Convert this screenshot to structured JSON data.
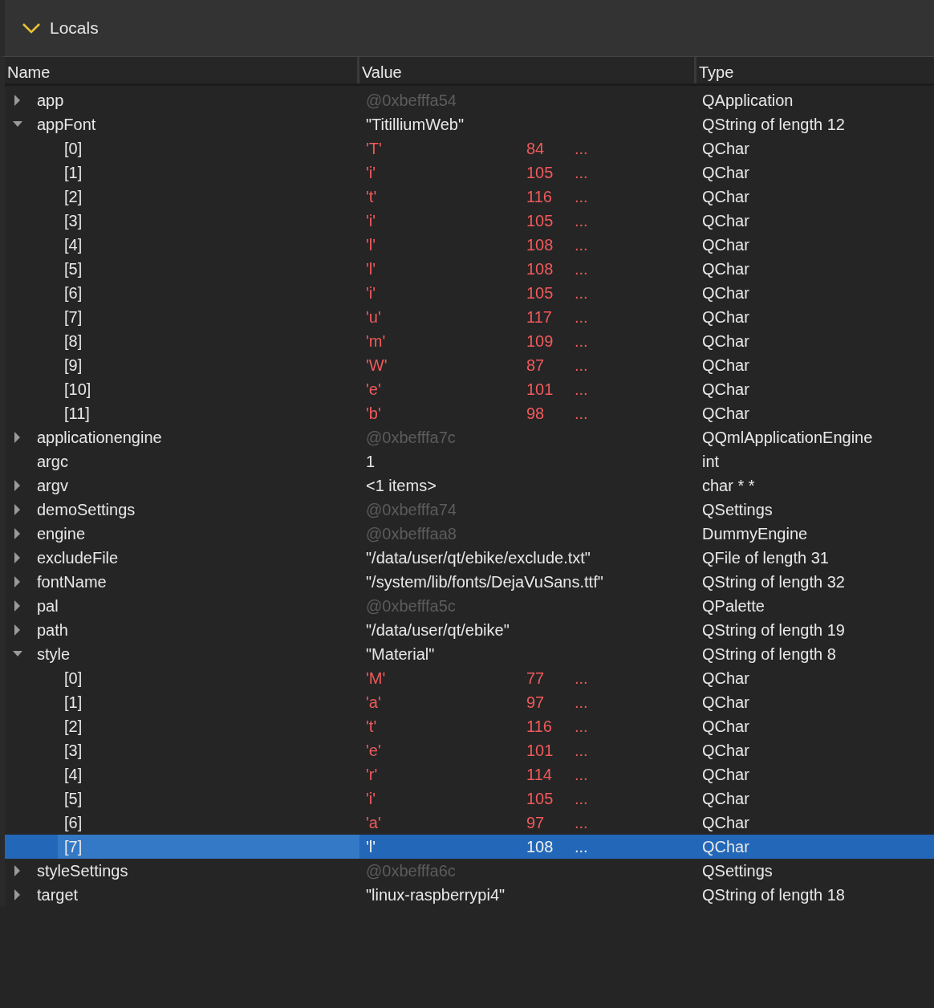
{
  "section": {
    "title": "Locals",
    "expanded": true
  },
  "columns": [
    "Name",
    "Value",
    "Type"
  ],
  "items": [
    {
      "name": "app",
      "kind": "address",
      "value": "@0xbefffa54",
      "type": "QApplication",
      "expandable": true,
      "expanded": false,
      "selected": false
    },
    {
      "name": "appFont",
      "kind": "text",
      "value": "\"TitilliumWeb\"",
      "type": "QString of length 12",
      "expandable": true,
      "expanded": true,
      "selected": false,
      "children": [
        {
          "name": "[0]",
          "kind": "char",
          "value": "'T'",
          "code": "84",
          "more": "...",
          "type": "QChar",
          "selected": false
        },
        {
          "name": "[1]",
          "kind": "char",
          "value": "'i'",
          "code": "105",
          "more": "...",
          "type": "QChar",
          "selected": false
        },
        {
          "name": "[2]",
          "kind": "char",
          "value": "'t'",
          "code": "116",
          "more": "...",
          "type": "QChar",
          "selected": false
        },
        {
          "name": "[3]",
          "kind": "char",
          "value": "'i'",
          "code": "105",
          "more": "...",
          "type": "QChar",
          "selected": false
        },
        {
          "name": "[4]",
          "kind": "char",
          "value": "'l'",
          "code": "108",
          "more": "...",
          "type": "QChar",
          "selected": false
        },
        {
          "name": "[5]",
          "kind": "char",
          "value": "'l'",
          "code": "108",
          "more": "...",
          "type": "QChar",
          "selected": false
        },
        {
          "name": "[6]",
          "kind": "char",
          "value": "'i'",
          "code": "105",
          "more": "...",
          "type": "QChar",
          "selected": false
        },
        {
          "name": "[7]",
          "kind": "char",
          "value": "'u'",
          "code": "117",
          "more": "...",
          "type": "QChar",
          "selected": false
        },
        {
          "name": "[8]",
          "kind": "char",
          "value": "'m'",
          "code": "109",
          "more": "...",
          "type": "QChar",
          "selected": false
        },
        {
          "name": "[9]",
          "kind": "char",
          "value": "'W'",
          "code": "87",
          "more": "...",
          "type": "QChar",
          "selected": false
        },
        {
          "name": "[10]",
          "kind": "char",
          "value": "'e'",
          "code": "101",
          "more": "...",
          "type": "QChar",
          "selected": false
        },
        {
          "name": "[11]",
          "kind": "char",
          "value": "'b'",
          "code": "98",
          "more": "...",
          "type": "QChar",
          "selected": false
        }
      ]
    },
    {
      "name": "applicationengine",
      "kind": "address",
      "value": "@0xbefffa7c",
      "type": "QQmlApplicationEngine",
      "expandable": true,
      "expanded": false,
      "selected": false
    },
    {
      "name": "argc",
      "kind": "text",
      "value": "1",
      "type": "int",
      "expandable": false,
      "selected": false
    },
    {
      "name": "argv",
      "kind": "text",
      "value": "<1 items>",
      "type": "char * *",
      "expandable": true,
      "expanded": false,
      "selected": false
    },
    {
      "name": "demoSettings",
      "kind": "address",
      "value": "@0xbefffa74",
      "type": "QSettings",
      "expandable": true,
      "expanded": false,
      "selected": false
    },
    {
      "name": "engine",
      "kind": "address",
      "value": "@0xbefffaa8",
      "type": "DummyEngine",
      "expandable": true,
      "expanded": false,
      "selected": false
    },
    {
      "name": "excludeFile",
      "kind": "text",
      "value": "\"/data/user/qt/ebike/exclude.txt\"",
      "type": "QFile of length 31",
      "expandable": true,
      "expanded": false,
      "selected": false
    },
    {
      "name": "fontName",
      "kind": "text",
      "value": "\"/system/lib/fonts/DejaVuSans.ttf\"",
      "type": "QString of length 32",
      "expandable": true,
      "expanded": false,
      "selected": false
    },
    {
      "name": "pal",
      "kind": "address",
      "value": "@0xbefffa5c",
      "type": "QPalette",
      "expandable": true,
      "expanded": false,
      "selected": false
    },
    {
      "name": "path",
      "kind": "text",
      "value": "\"/data/user/qt/ebike\"",
      "type": "QString of length 19",
      "expandable": true,
      "expanded": false,
      "selected": false
    },
    {
      "name": "style",
      "kind": "text",
      "value": "\"Material\"",
      "type": "QString of length 8",
      "expandable": true,
      "expanded": true,
      "selected": false,
      "children": [
        {
          "name": "[0]",
          "kind": "char",
          "value": "'M'",
          "code": "77",
          "more": "...",
          "type": "QChar",
          "selected": false
        },
        {
          "name": "[1]",
          "kind": "char",
          "value": "'a'",
          "code": "97",
          "more": "...",
          "type": "QChar",
          "selected": false
        },
        {
          "name": "[2]",
          "kind": "char",
          "value": "'t'",
          "code": "116",
          "more": "...",
          "type": "QChar",
          "selected": false
        },
        {
          "name": "[3]",
          "kind": "char",
          "value": "'e'",
          "code": "101",
          "more": "...",
          "type": "QChar",
          "selected": false
        },
        {
          "name": "[4]",
          "kind": "char",
          "value": "'r'",
          "code": "114",
          "more": "...",
          "type": "QChar",
          "selected": false
        },
        {
          "name": "[5]",
          "kind": "char",
          "value": "'i'",
          "code": "105",
          "more": "...",
          "type": "QChar",
          "selected": false
        },
        {
          "name": "[6]",
          "kind": "char",
          "value": "'a'",
          "code": "97",
          "more": "...",
          "type": "QChar",
          "selected": false
        },
        {
          "name": "[7]",
          "kind": "char",
          "value": "'l'",
          "code": "108",
          "more": "...",
          "type": "QChar",
          "selected": true
        }
      ]
    },
    {
      "name": "styleSettings",
      "kind": "address",
      "value": "@0xbefffa6c",
      "type": "QSettings",
      "expandable": true,
      "expanded": false,
      "selected": false
    },
    {
      "name": "target",
      "kind": "text",
      "value": "\"linux-raspberrypi4\"",
      "type": "QString of length 18",
      "expandable": true,
      "expanded": false,
      "selected": false
    }
  ]
}
